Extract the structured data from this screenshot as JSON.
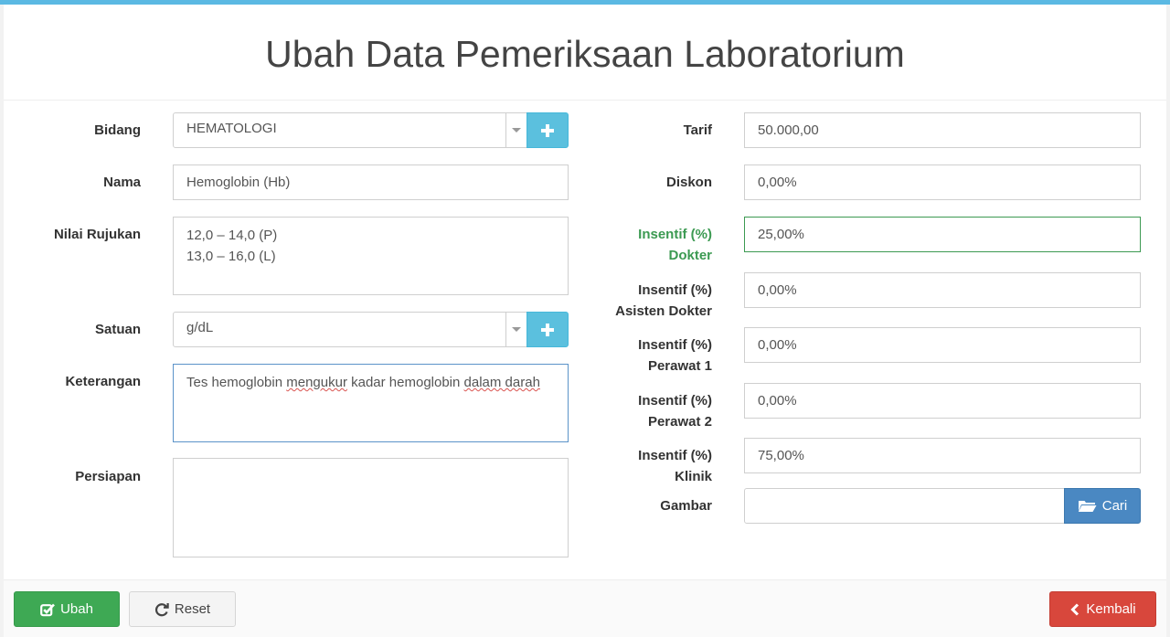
{
  "page": {
    "title": "Ubah Data Pemeriksaan Laboratorium"
  },
  "left": {
    "bidang": {
      "label": "Bidang",
      "value": "HEMATOLOGI"
    },
    "nama": {
      "label": "Nama",
      "value": "Hemoglobin (Hb)"
    },
    "nilai_rujukan": {
      "label": "Nilai Rujukan",
      "lines": [
        "12,0 – 14,0 (P)",
        "13,0 – 16,0 (L)"
      ]
    },
    "satuan": {
      "label": "Satuan",
      "value": "g/dL"
    },
    "keterangan": {
      "label": "Keterangan",
      "parts": [
        "Tes hemoglobin ",
        "mengukur",
        " kadar hemoglobin ",
        "dalam darah"
      ]
    },
    "persiapan": {
      "label": "Persiapan",
      "value": ""
    }
  },
  "right": {
    "tarif": {
      "label": "Tarif",
      "value": "50.000,00"
    },
    "diskon": {
      "label": "Diskon",
      "value": "0,00%"
    },
    "insentif_dokter": {
      "label_1": "Insentif (%)",
      "label_2": "Dokter",
      "value": "25,00%"
    },
    "insentif_asisten": {
      "label_1": "Insentif (%)",
      "label_2": "Asisten Dokter",
      "value": "0,00%"
    },
    "insentif_perawat1": {
      "label_1": "Insentif (%)",
      "label_2": "Perawat 1",
      "value": "0,00%"
    },
    "insentif_perawat2": {
      "label_1": "Insentif (%)",
      "label_2": "Perawat 2",
      "value": "0,00%"
    },
    "insentif_klinik": {
      "label_1": "Insentif (%)",
      "label_2": "Klinik",
      "value": "75,00%"
    },
    "gambar": {
      "label": "Gambar",
      "value": "",
      "button": "Cari"
    }
  },
  "footer": {
    "ubah": "Ubah",
    "reset": "Reset",
    "kembali": "Kembali"
  },
  "icons": {
    "add": "plus-icon",
    "caret": "caret-down-icon",
    "folder": "folder-open-icon",
    "edit": "edit-check-icon",
    "reset": "refresh-icon",
    "back": "chevron-left-icon"
  },
  "colors": {
    "accent_top": "#5bb9e3",
    "info": "#5bc0de",
    "primary": "#4a88c2",
    "success": "#3ea954",
    "danger": "#d8473c",
    "success_label": "#3c9a52"
  }
}
